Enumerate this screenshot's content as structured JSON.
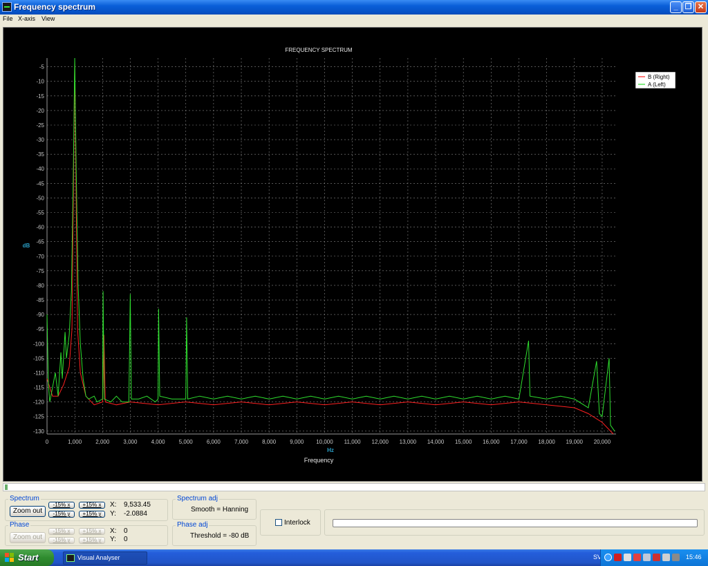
{
  "window": {
    "title": "Frequency spectrum",
    "controls": {
      "minimize": "_",
      "maximize": "❐",
      "close": "✕"
    }
  },
  "menu": [
    "File",
    "X-axis",
    "View"
  ],
  "chart_data": {
    "type": "line",
    "title": "FREQUENCY SPECTRUM",
    "xlabel": "Frequency",
    "xunit": "Hz",
    "ylabel": "dB",
    "xlim": [
      0,
      20500
    ],
    "ylim": [
      -131,
      -2
    ],
    "xticks": [
      0,
      1000,
      2000,
      3000,
      4000,
      5000,
      6000,
      7000,
      8000,
      9000,
      10000,
      11000,
      12000,
      13000,
      14000,
      15000,
      16000,
      17000,
      18000,
      19000,
      20000
    ],
    "xtick_labels": [
      "0",
      "1,000",
      "2,000",
      "3,000",
      "4,000",
      "5,000",
      "6,000",
      "7,000",
      "8,000",
      "9,000",
      "10,000",
      "11,000",
      "12,000",
      "13,000",
      "14,000",
      "15,000",
      "16,000",
      "17,000",
      "18,000",
      "19,000",
      "20,000"
    ],
    "yticks": [
      -5,
      -10,
      -15,
      -20,
      -25,
      -30,
      -35,
      -40,
      -45,
      -50,
      -55,
      -60,
      -65,
      -70,
      -75,
      -80,
      -85,
      -90,
      -95,
      -100,
      -105,
      -110,
      -115,
      -120,
      -125,
      -130
    ],
    "ytick_labels": [
      "-5",
      "-10",
      "-15",
      "-20",
      "-25",
      "-30",
      "-35",
      "-40",
      "-45",
      "-50",
      "-55",
      "-60",
      "-65",
      "-70",
      "-75",
      "-80",
      "-85",
      "-90",
      "-95",
      "-100",
      "-105",
      "-110",
      "-115",
      "-120",
      "-125",
      "-130"
    ],
    "grid": true,
    "legend_position": "top-right",
    "series": [
      {
        "name": "B (Right)",
        "color": "#ff2020",
        "points": [
          [
            0,
            -112
          ],
          [
            200,
            -118
          ],
          [
            400,
            -118
          ],
          [
            600,
            -114
          ],
          [
            800,
            -108
          ],
          [
            900,
            -95
          ],
          [
            1000,
            -4
          ],
          [
            1100,
            -95
          ],
          [
            1200,
            -110
          ],
          [
            1400,
            -118
          ],
          [
            1700,
            -121
          ],
          [
            2000,
            -120
          ],
          [
            2050,
            -97
          ],
          [
            2100,
            -120
          ],
          [
            2500,
            -121
          ],
          [
            3000,
            -120
          ],
          [
            4000,
            -121
          ],
          [
            5000,
            -120
          ],
          [
            6000,
            -121
          ],
          [
            7000,
            -120
          ],
          [
            8000,
            -121
          ],
          [
            9000,
            -120
          ],
          [
            10000,
            -121
          ],
          [
            11000,
            -120
          ],
          [
            12000,
            -121
          ],
          [
            13000,
            -120
          ],
          [
            14000,
            -121
          ],
          [
            15000,
            -120
          ],
          [
            16000,
            -121
          ],
          [
            17000,
            -120
          ],
          [
            18000,
            -121
          ],
          [
            19000,
            -122
          ],
          [
            19500,
            -124
          ],
          [
            20000,
            -127
          ],
          [
            20400,
            -131
          ]
        ]
      },
      {
        "name": "A (Left)",
        "color": "#2ee02e",
        "points": [
          [
            0,
            -90
          ],
          [
            50,
            -114
          ],
          [
            100,
            -120
          ],
          [
            200,
            -115
          ],
          [
            300,
            -110
          ],
          [
            400,
            -118
          ],
          [
            500,
            -103
          ],
          [
            550,
            -112
          ],
          [
            650,
            -96
          ],
          [
            700,
            -105
          ],
          [
            800,
            -97
          ],
          [
            880,
            -82
          ],
          [
            950,
            -40
          ],
          [
            1000,
            -2
          ],
          [
            1050,
            -40
          ],
          [
            1120,
            -80
          ],
          [
            1200,
            -100
          ],
          [
            1300,
            -112
          ],
          [
            1400,
            -118
          ],
          [
            1500,
            -119
          ],
          [
            1700,
            -118
          ],
          [
            1800,
            -120
          ],
          [
            2000,
            -119
          ],
          [
            2020,
            -82
          ],
          [
            2060,
            -119
          ],
          [
            2300,
            -120
          ],
          [
            2500,
            -118
          ],
          [
            2700,
            -120
          ],
          [
            2950,
            -120
          ],
          [
            3000,
            -83
          ],
          [
            3040,
            -119
          ],
          [
            3300,
            -119
          ],
          [
            3600,
            -118
          ],
          [
            3900,
            -120
          ],
          [
            4000,
            -119
          ],
          [
            4020,
            -88
          ],
          [
            4060,
            -118
          ],
          [
            4500,
            -119
          ],
          [
            5000,
            -119
          ],
          [
            5030,
            -91
          ],
          [
            5070,
            -119
          ],
          [
            5500,
            -118
          ],
          [
            6000,
            -119
          ],
          [
            6500,
            -118
          ],
          [
            7000,
            -119
          ],
          [
            7500,
            -118
          ],
          [
            8000,
            -119
          ],
          [
            8500,
            -118
          ],
          [
            9000,
            -119
          ],
          [
            9500,
            -118
          ],
          [
            10000,
            -119
          ],
          [
            10500,
            -118
          ],
          [
            11000,
            -119
          ],
          [
            11500,
            -118
          ],
          [
            12000,
            -119
          ],
          [
            12500,
            -118
          ],
          [
            13000,
            -119
          ],
          [
            13500,
            -118
          ],
          [
            14000,
            -119
          ],
          [
            14500,
            -118
          ],
          [
            15000,
            -119
          ],
          [
            15500,
            -118
          ],
          [
            16000,
            -119
          ],
          [
            16500,
            -118
          ],
          [
            17000,
            -119
          ],
          [
            17350,
            -99
          ],
          [
            17400,
            -118
          ],
          [
            18000,
            -119
          ],
          [
            18500,
            -118
          ],
          [
            19000,
            -119
          ],
          [
            19500,
            -122
          ],
          [
            19800,
            -106
          ],
          [
            19900,
            -124
          ],
          [
            20000,
            -125
          ],
          [
            20250,
            -105
          ],
          [
            20300,
            -128
          ],
          [
            20450,
            -130
          ]
        ]
      }
    ]
  },
  "controls": {
    "spectrum": {
      "label": "Spectrum",
      "zoom_out": "Zoom out",
      "minus_x": "-15% x",
      "plus_x": "+15% x",
      "minus_y": "-15% y",
      "plus_y": "+15% y",
      "x_label": "X:",
      "x_value": "9,533.45",
      "y_label": "Y:",
      "y_value": "-2.0884"
    },
    "phase": {
      "label": "Phase",
      "zoom_out": "Zoom out",
      "minus_x": "-15% x",
      "plus_x": "+15% x",
      "minus_y": "-15% y",
      "plus_y": "+15% y",
      "x_label": "X:",
      "x_value": "0",
      "y_label": "Y:",
      "y_value": "0"
    },
    "spectrum_adj": {
      "label": "Spectrum adj",
      "text": "Smooth = Hanning"
    },
    "phase_adj": {
      "label": "Phase adj",
      "text": "Threshold = -80 dB"
    },
    "interlock": {
      "label": "Interlock"
    }
  },
  "taskbar": {
    "start": "Start",
    "task": "Visual Analyser",
    "language": "SV",
    "time": "15:46"
  }
}
